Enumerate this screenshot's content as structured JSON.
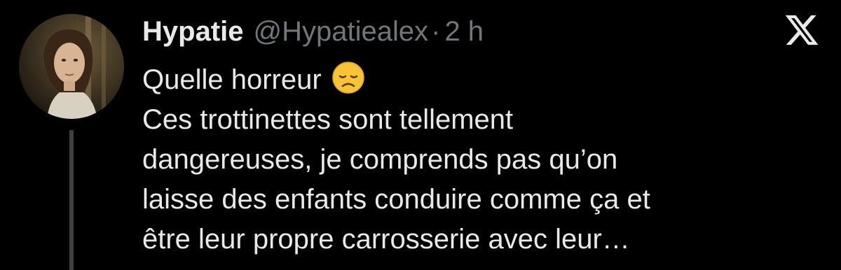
{
  "author": {
    "display_name": "Hypatie",
    "handle": "@Hypatiealex",
    "separator": "·",
    "time": "2 h"
  },
  "icons": {
    "platform_logo": "x-logo-icon",
    "emoji": "disappointed-face-emoji"
  },
  "tweet": {
    "lines": [
      "Quelle horreur",
      "Ces trottinettes sont tellement",
      "dangereuses, je comprends pas qu’on",
      "laisse des enfants conduire comme ça et",
      "être leur propre carrosserie avec leur…"
    ]
  },
  "colors": {
    "background": "#000000",
    "text_primary": "#e7e9ea",
    "text_secondary": "#71767b",
    "thread_line": "#3e4144"
  }
}
